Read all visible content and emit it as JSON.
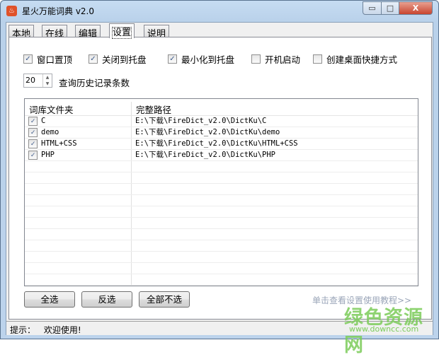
{
  "window": {
    "title": "星火万能词典 v2.0",
    "minimize": "▭",
    "maximize": "□",
    "close": "X"
  },
  "tabs": [
    {
      "label": "本地"
    },
    {
      "label": "在线"
    },
    {
      "label": "编辑"
    },
    {
      "label": "设置"
    },
    {
      "label": "说明"
    }
  ],
  "options": [
    {
      "label": "窗口置顶",
      "checked": true
    },
    {
      "label": "关闭到托盘",
      "checked": true
    },
    {
      "label": "最小化到托盘",
      "checked": true
    },
    {
      "label": "开机启动",
      "checked": false
    },
    {
      "label": "创建桌面快捷方式",
      "checked": false
    }
  ],
  "history": {
    "value": "20",
    "label": "查询历史记录条数"
  },
  "list": {
    "headers": [
      "词库文件夹",
      "完整路径"
    ],
    "rows": [
      {
        "name": "C",
        "path": "E:\\下载\\FireDict_v2.0\\DictKu\\C",
        "checked": true
      },
      {
        "name": "demo",
        "path": "E:\\下载\\FireDict_v2.0\\DictKu\\demo",
        "checked": true
      },
      {
        "name": "HTML+CSS",
        "path": "E:\\下载\\FireDict_v2.0\\DictKu\\HTML+CSS",
        "checked": true
      },
      {
        "name": "PHP",
        "path": "E:\\下载\\FireDict_v2.0\\DictKu\\PHP",
        "checked": true
      }
    ]
  },
  "buttons": {
    "select_all": "全选",
    "invert": "反选",
    "select_none": "全部不选"
  },
  "help_link": "单击查看设置使用教程>>",
  "status": {
    "label": "提示：",
    "message": "欢迎使用!"
  },
  "watermark": {
    "text": "绿色资源网",
    "url": "www.downcc.com"
  }
}
